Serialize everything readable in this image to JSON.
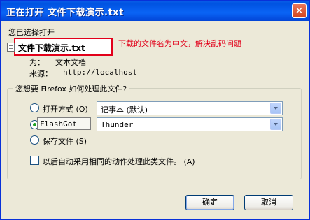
{
  "window": {
    "title": "正在打开 文件下载演示.txt"
  },
  "dialog": {
    "chosen_label": "您已选择打开",
    "file_name": "文件下载演示.txt",
    "annotation": "下载的文件名为中文，解决乱码问题",
    "type_label": "为：",
    "type_value": "文本文档",
    "from_label": "来源：",
    "from_value": "http://localhost",
    "question": "您想要 Firefox 如何处理此文件?",
    "open_with_label": "打开方式 (O)",
    "open_with_value": "记事本 (默认)",
    "flashgot_label": "FlashGot",
    "flashgot_value": "Thunder",
    "save_label": "保存文件 (S)",
    "auto_label": "以后自动采用相同的动作处理此类文件。 (A)",
    "ok_label": "确定",
    "cancel_label": "取消",
    "selected_option": "FlashGot",
    "annotation_color": "#e2001a"
  }
}
